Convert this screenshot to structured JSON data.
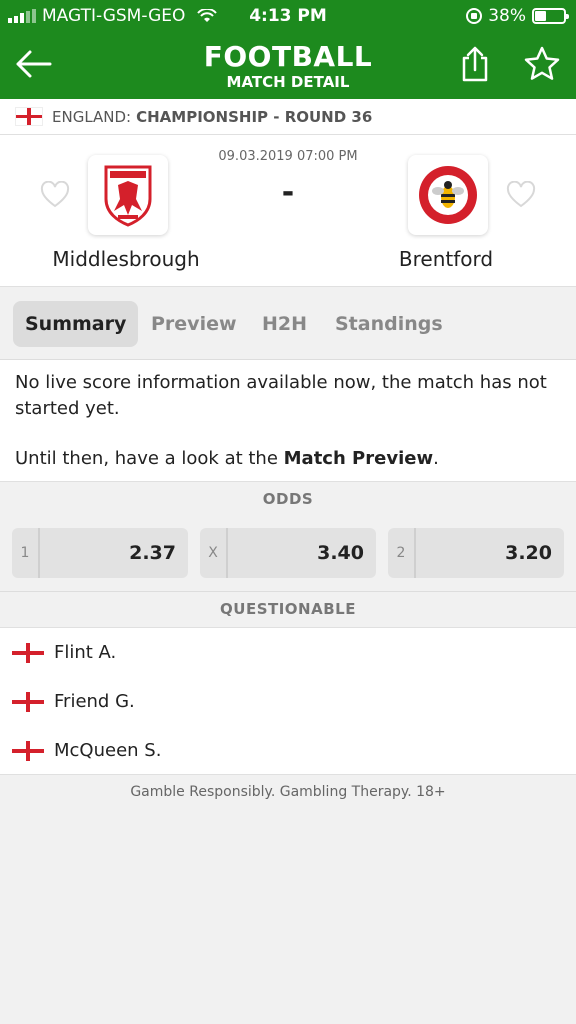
{
  "status_bar": {
    "carrier": "MAGTI-GSM-GEO",
    "time": "4:13 PM",
    "battery": "38%",
    "battery_level": 0.38
  },
  "header": {
    "title": "FOOTBALL",
    "subtitle": "MATCH DETAIL",
    "back_icon": "arrow-left-icon",
    "share_icon": "share-icon",
    "favorite_icon": "star-icon"
  },
  "league": {
    "country": "ENGLAND:",
    "name": "CHAMPIONSHIP - ROUND 36"
  },
  "match": {
    "datetime": "09.03.2019 07:00 PM",
    "score": "-",
    "home": {
      "name": "Middlesbrough",
      "badge_color": "#d4202b"
    },
    "away": {
      "name": "Brentford",
      "badge_color": "#d4202b"
    }
  },
  "tabs": [
    "Summary",
    "Preview",
    "H2H",
    "Standings"
  ],
  "active_tab": "Summary",
  "info": {
    "line1": "No live score information available now, the match has not started yet.",
    "line2_prefix": "Until then, have a look at the ",
    "line2_link": "Match Preview",
    "line2_suffix": "."
  },
  "odds": {
    "heading": "ODDS",
    "items": [
      {
        "key": "1",
        "value": "2.37"
      },
      {
        "key": "X",
        "value": "3.40"
      },
      {
        "key": "2",
        "value": "3.20"
      }
    ]
  },
  "questionable": {
    "heading": "QUESTIONABLE",
    "players": [
      "Flint A.",
      "Friend G.",
      "McQueen S."
    ]
  },
  "footer": "Gamble Responsibly. Gambling Therapy. 18+",
  "colors": {
    "header_green": "#1d8a1e",
    "flag_red": "#d4202b"
  }
}
